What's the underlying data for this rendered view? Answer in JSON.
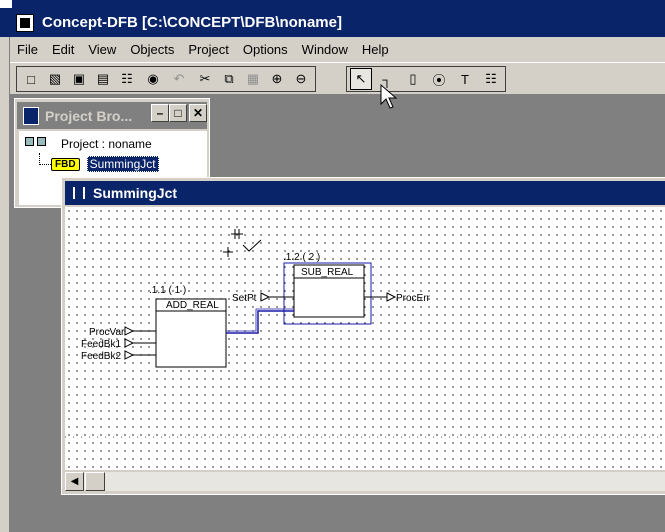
{
  "app": {
    "title": "Concept-DFB [C:\\CONCEPT\\DFB\\noname]"
  },
  "menu": [
    "File",
    "Edit",
    "View",
    "Objects",
    "Project",
    "Options",
    "Window",
    "Help"
  ],
  "toolbar": {
    "buttons": [
      {
        "name": "new-icon",
        "glyph": "□",
        "enabled": true
      },
      {
        "name": "open-icon",
        "glyph": "▧",
        "enabled": true
      },
      {
        "name": "save-icon",
        "glyph": "▣",
        "enabled": true
      },
      {
        "name": "properties-icon",
        "glyph": "▤",
        "enabled": true
      },
      {
        "name": "tree-icon",
        "glyph": "☷",
        "enabled": true
      },
      {
        "name": "find-icon",
        "glyph": "◉",
        "enabled": true
      },
      {
        "name": "undo-icon",
        "glyph": "↶",
        "enabled": false
      },
      {
        "name": "cut-icon",
        "glyph": "✂",
        "enabled": true
      },
      {
        "name": "copy-icon",
        "glyph": "⧉",
        "enabled": true
      },
      {
        "name": "paste-icon",
        "glyph": "▦",
        "enabled": false
      },
      {
        "name": "zoom-in-icon",
        "glyph": "⊕",
        "enabled": true
      },
      {
        "name": "zoom-out-icon",
        "glyph": "⊖",
        "enabled": true
      }
    ],
    "tools": [
      {
        "name": "select-tool-icon",
        "glyph": "↖",
        "active": true
      },
      {
        "name": "link-tool-icon",
        "glyph": "┐",
        "active": false
      },
      {
        "name": "block-tool-icon",
        "glyph": "▯",
        "active": false
      },
      {
        "name": "pin-tool-icon",
        "glyph": "⦿",
        "active": false
      },
      {
        "name": "text-tool-icon",
        "glyph": "T",
        "active": false
      },
      {
        "name": "grid-tool-icon",
        "glyph": "☷",
        "active": false
      }
    ]
  },
  "project_browser": {
    "title": "Project Bro...",
    "root": "Project : noname",
    "child_badge": "FBD",
    "child": "SummingJct"
  },
  "fbd_window": {
    "title": "SummingJct",
    "blocks": [
      {
        "instance": ".1.1 ( 1 )",
        "type": "ADD_REAL",
        "inputs": [
          "ProcVar",
          "FeedBk1",
          "FeedBk2"
        ]
      },
      {
        "instance": ".1.2 ( 2 )",
        "type": "SUB_REAL",
        "inputs": [
          "SetPt"
        ],
        "outputs": [
          "ProcErr"
        ]
      }
    ]
  },
  "colors": {
    "titlebar": "#0a246a",
    "link": "#1a1aa8",
    "face": "#d4d0c8"
  }
}
